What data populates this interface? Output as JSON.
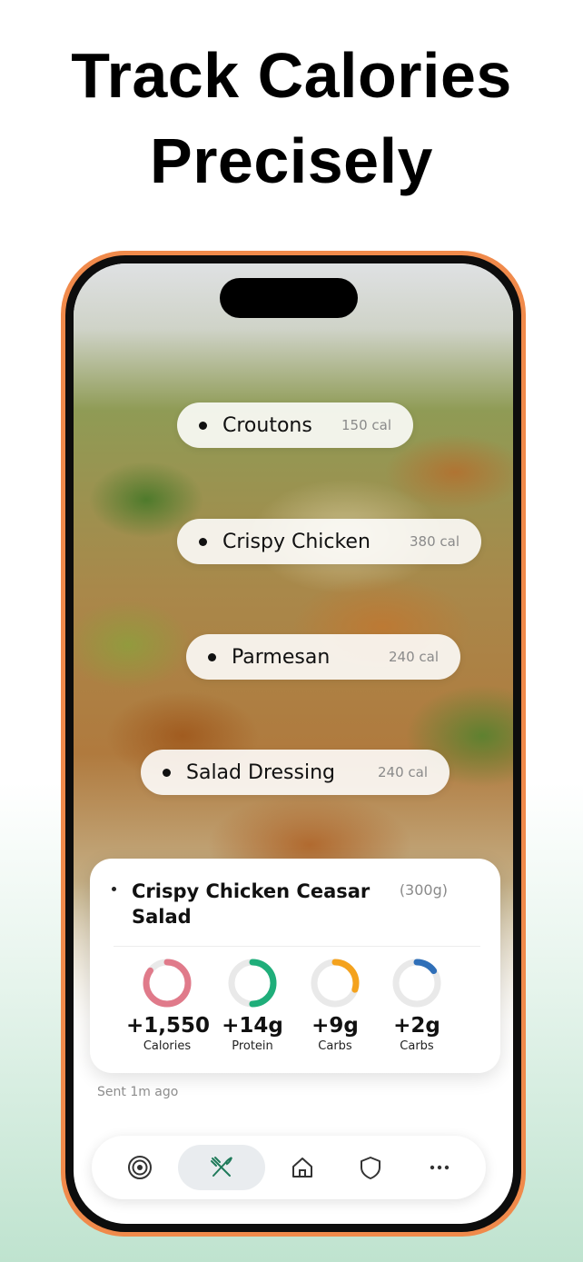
{
  "headline": {
    "line1": "Track Calories",
    "line2": "Precisely"
  },
  "ingredients": [
    {
      "name": "Croutons",
      "calories": "150 cal"
    },
    {
      "name": "Crispy Chicken",
      "calories": "380 cal"
    },
    {
      "name": "Parmesan",
      "calories": "240 cal"
    },
    {
      "name": "Salad Dressing",
      "calories": "240 cal"
    }
  ],
  "meal_card": {
    "title": "Crispy Chicken Ceasar Salad",
    "weight": "(300g)",
    "macros": [
      {
        "value": "+1,550",
        "label": "Calories",
        "color": "#e07a8a",
        "fill": 0.85
      },
      {
        "value": "+14g",
        "label": "Protein",
        "color": "#1fae7a",
        "fill": 0.5
      },
      {
        "value": "+9g",
        "label": "Carbs",
        "color": "#f4a21d",
        "fill": 0.3
      },
      {
        "value": "+2g",
        "label": "Carbs",
        "color": "#2f6fb8",
        "fill": 0.15
      }
    ]
  },
  "sent_text": "Sent 1m ago",
  "tabbar": {
    "items": [
      {
        "icon": "target-icon",
        "active": false
      },
      {
        "icon": "fork-knife-icon",
        "active": true
      },
      {
        "icon": "home-icon",
        "active": false
      },
      {
        "icon": "shield-icon",
        "active": false
      },
      {
        "icon": "more-dots-icon",
        "active": false
      }
    ],
    "accent": "#1f7a5a"
  },
  "colors": {
    "phone_frame": "#f08a4b"
  }
}
